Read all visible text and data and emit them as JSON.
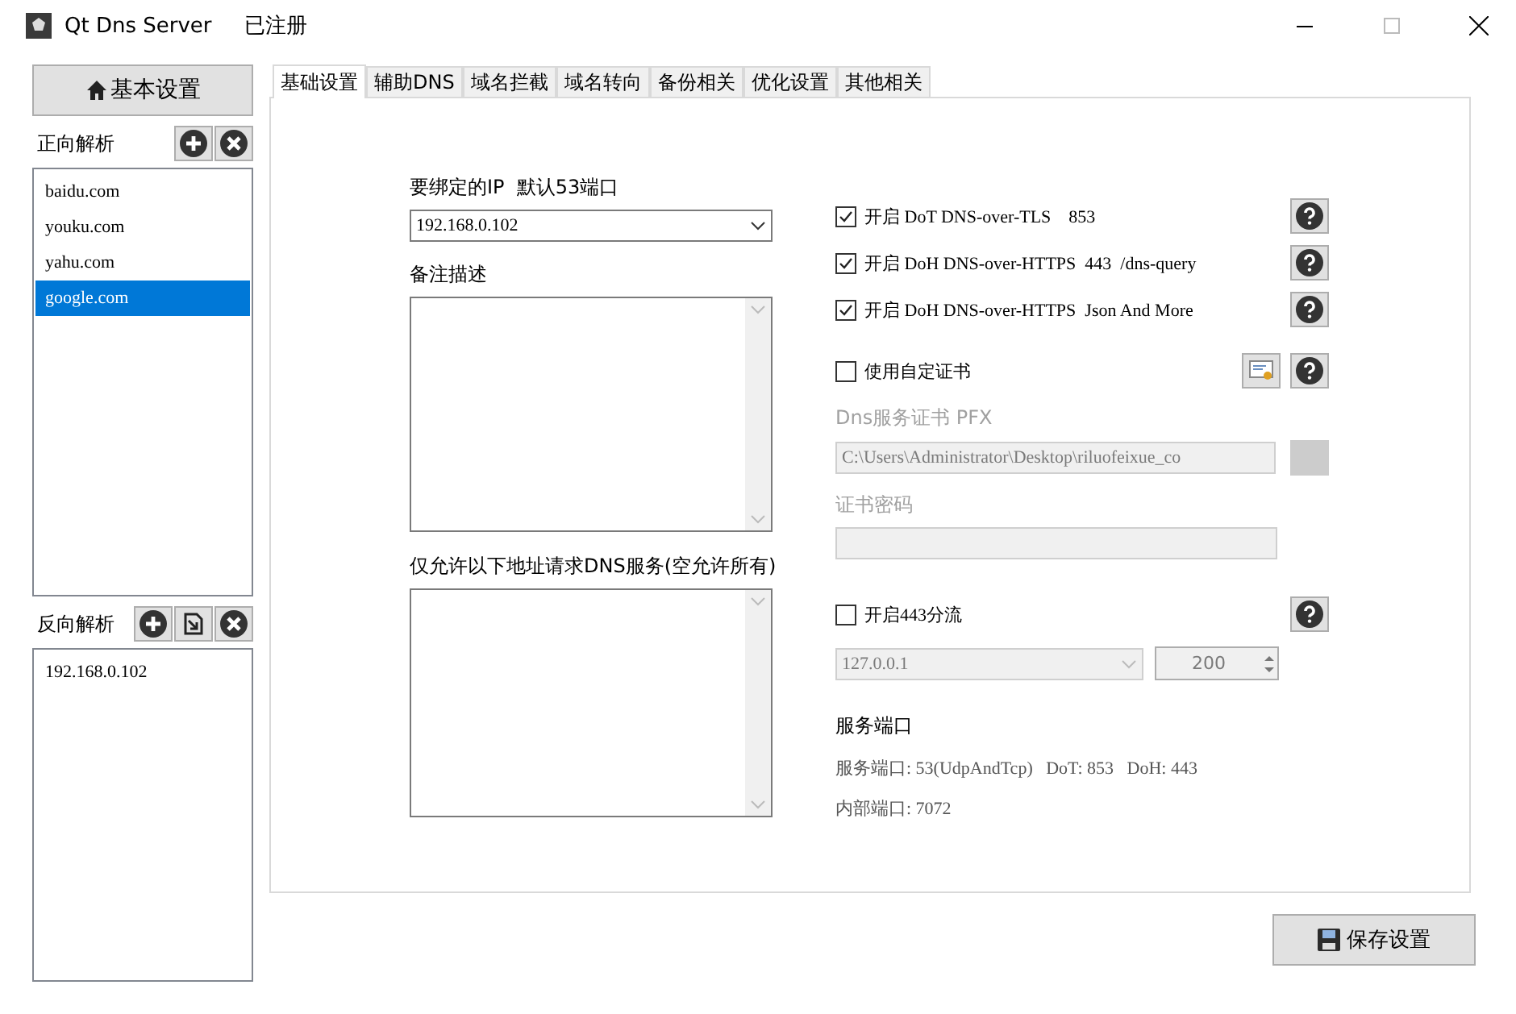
{
  "window": {
    "title": "Qt Dns Server",
    "status": "已注册"
  },
  "sidebar": {
    "home_button": "基本设置",
    "forward": {
      "label": "正向解析",
      "items": [
        {
          "label": "baidu.com",
          "selected": false
        },
        {
          "label": "youku.com",
          "selected": false
        },
        {
          "label": "yahu.com",
          "selected": false
        },
        {
          "label": "google.com",
          "selected": true
        }
      ]
    },
    "reverse": {
      "label": "反向解析",
      "items": [
        {
          "label": "192.168.0.102",
          "selected": false
        }
      ]
    }
  },
  "tabs": [
    {
      "label": "基础设置",
      "selected": true
    },
    {
      "label": "辅助DNS",
      "selected": false
    },
    {
      "label": "域名拦截",
      "selected": false
    },
    {
      "label": "域名转向",
      "selected": false
    },
    {
      "label": "备份相关",
      "selected": false
    },
    {
      "label": "优化设置",
      "selected": false
    },
    {
      "label": "其他相关",
      "selected": false
    }
  ],
  "basic": {
    "bind_ip": {
      "label": "要绑定的IP  默认53端口",
      "value": "192.168.0.102"
    },
    "note": {
      "label": "备注描述"
    },
    "allow": {
      "label": "仅允许以下地址请求DNS服务(空允许所有)"
    },
    "options": [
      {
        "label": "开启 DoT DNS-over-TLS    853",
        "checked": true
      },
      {
        "label": "开启 DoH DNS-over-HTTPS  443  /dns-query",
        "checked": true
      },
      {
        "label": "开启 DoH DNS-over-HTTPS  Json And More",
        "checked": true
      }
    ],
    "custom_cert": {
      "label": "使用自定证书",
      "checked": false
    },
    "cert_file": {
      "label": "Dns服务证书 PFX",
      "value": "C:\\Users\\Administrator\\Desktop\\riluofeixue_co",
      "disabled": true
    },
    "cert_password": {
      "label": "证书密码",
      "disabled": true
    },
    "split443": {
      "label": "开启443分流",
      "checked": false,
      "address": "127.0.0.1",
      "count": "200",
      "disabled": true
    },
    "ports": {
      "title": "服务端口",
      "lines": [
        "服务端口: 53(UdpAndTcp)   DoT: 853   DoH: 443",
        "内部端口: 7072"
      ]
    }
  },
  "save_button": "保存设置"
}
